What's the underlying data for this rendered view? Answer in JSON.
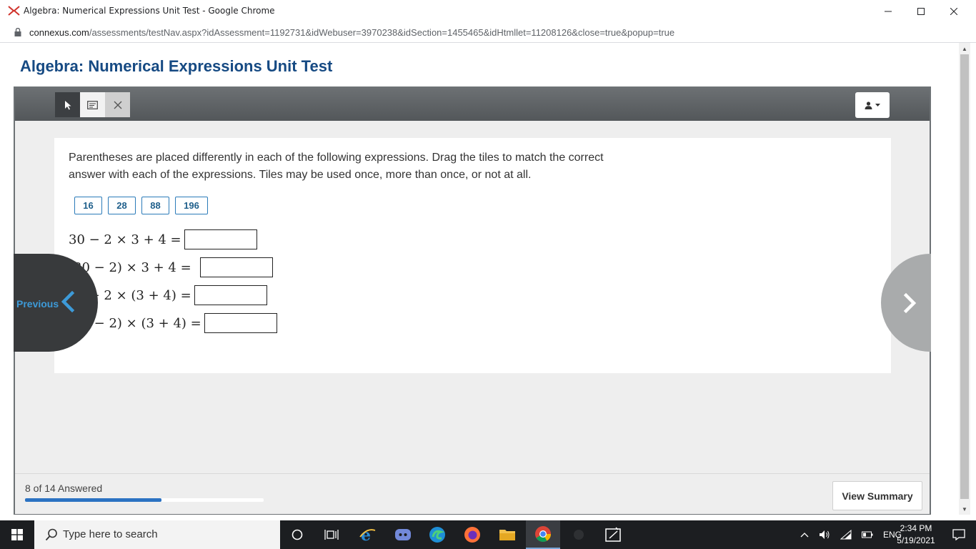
{
  "window": {
    "title": "Algebra: Numerical Expressions Unit Test - Google Chrome",
    "url_host": "connexus.com",
    "url_path": "/assessments/testNav.aspx?idAssessment=1192731&idWebuser=3970238&idSection=1455465&idHtmllet=11208126&close=true&popup=true"
  },
  "page": {
    "title": "Algebra: Numerical Expressions Unit Test"
  },
  "question": {
    "prompt": "Parentheses are placed differently in each of the following expressions. Drag the tiles to match the correct answer with each of the expressions. Tiles may be used once, more than once, or not at all.",
    "tiles": [
      "16",
      "28",
      "88",
      "196"
    ],
    "expressions": [
      "30 − 2 × 3 + 4 =",
      "(30 − 2) × 3 + 4 =",
      "30 − 2 × (3 + 4) =",
      "(30 − 2) × (3 + 4) ="
    ]
  },
  "navigation": {
    "previous_label": "Previous"
  },
  "footer": {
    "answered_text": "8 of 14 Answered",
    "answered_count": 8,
    "total_questions": 14,
    "summary_button": "View Summary"
  },
  "taskbar": {
    "search_placeholder": "Type here to search",
    "language": "ENG",
    "time": "2:34 PM",
    "date": "5/19/2021"
  },
  "colors": {
    "title_blue": "#164a83",
    "tile_border": "#2b7bb9",
    "progress_fill": "#2b72c2",
    "previous_label": "#3d9ad8"
  },
  "icons": {
    "toolbar": [
      "pointer-icon",
      "notes-icon",
      "close-icon"
    ],
    "user_menu": "user-icon",
    "nav": [
      "chevron-left-icon",
      "chevron-right-icon"
    ]
  }
}
